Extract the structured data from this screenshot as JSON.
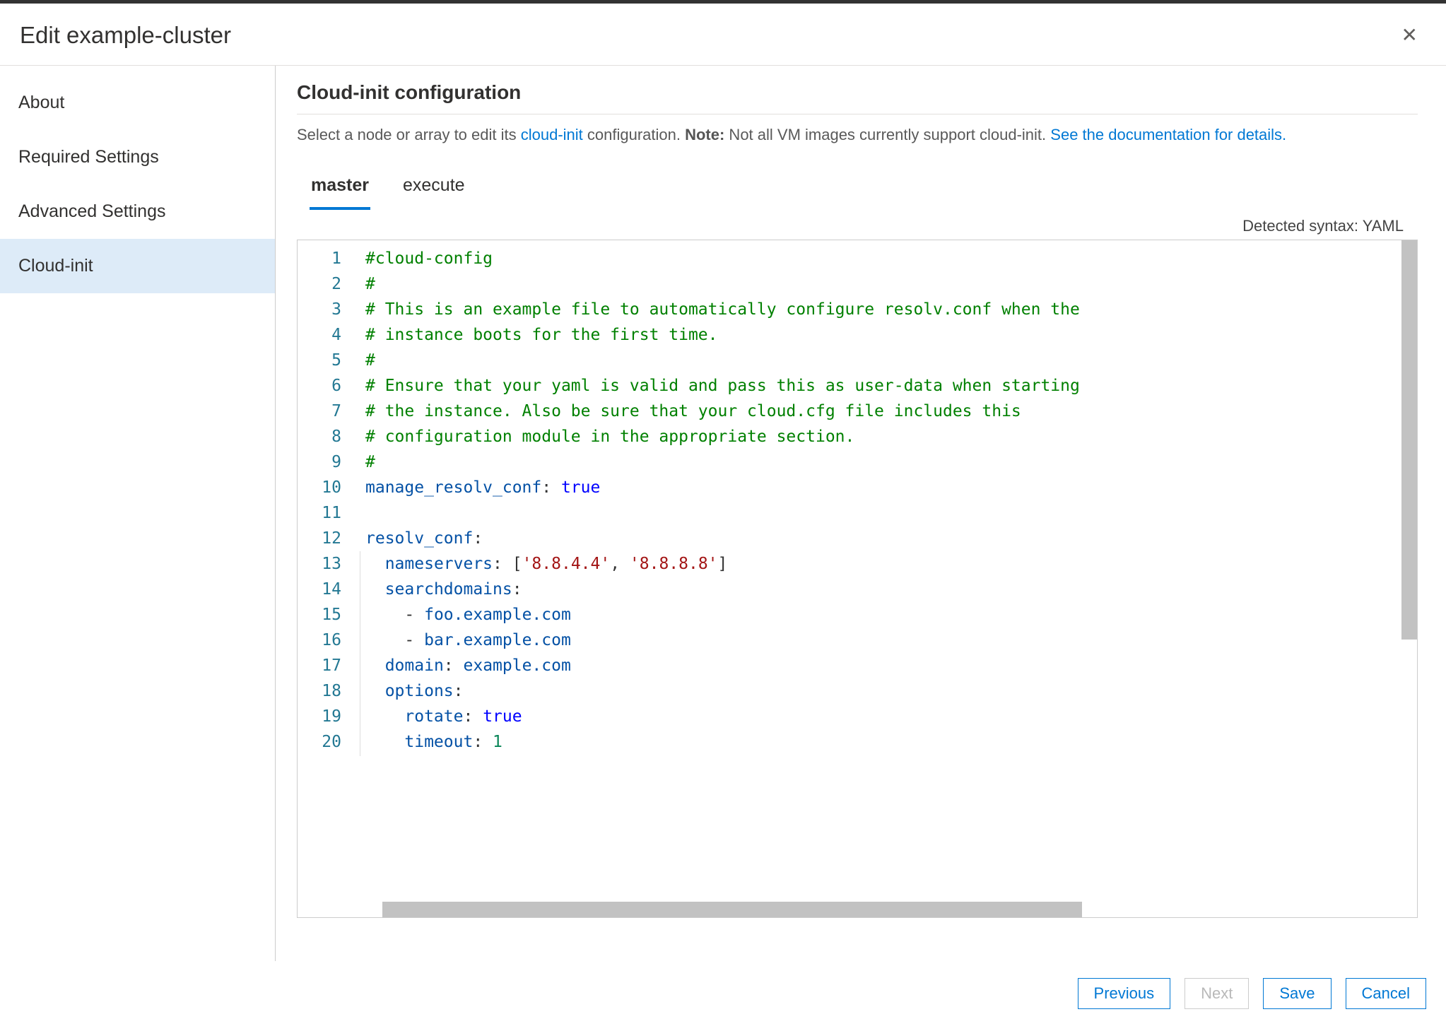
{
  "header": {
    "title": "Edit example-cluster"
  },
  "sidebar": {
    "items": [
      {
        "label": "About"
      },
      {
        "label": "Required Settings"
      },
      {
        "label": "Advanced Settings"
      },
      {
        "label": "Cloud-init"
      }
    ]
  },
  "main": {
    "section_title": "Cloud-init configuration",
    "subtitle_pre": "Select a node or array to edit its ",
    "subtitle_link1": "cloud-init",
    "subtitle_mid": " configuration. ",
    "subtitle_note_label": "Note:",
    "subtitle_note_text": " Not all VM images currently support cloud-init. ",
    "subtitle_link2": "See the documentation for details.",
    "tabs": [
      {
        "label": "master"
      },
      {
        "label": "execute"
      }
    ],
    "syntax_label": "Detected syntax: YAML"
  },
  "editor": {
    "lines": [
      {
        "n": "1",
        "tokens": [
          {
            "c": "comment",
            "t": "#cloud-config"
          }
        ]
      },
      {
        "n": "2",
        "tokens": [
          {
            "c": "comment",
            "t": "#"
          }
        ]
      },
      {
        "n": "3",
        "tokens": [
          {
            "c": "comment",
            "t": "# This is an example file to automatically configure resolv.conf when the"
          }
        ]
      },
      {
        "n": "4",
        "tokens": [
          {
            "c": "comment",
            "t": "# instance boots for the first time."
          }
        ]
      },
      {
        "n": "5",
        "tokens": [
          {
            "c": "comment",
            "t": "#"
          }
        ]
      },
      {
        "n": "6",
        "tokens": [
          {
            "c": "comment",
            "t": "# Ensure that your yaml is valid and pass this as user-data when starting"
          }
        ]
      },
      {
        "n": "7",
        "tokens": [
          {
            "c": "comment",
            "t": "# the instance. Also be sure that your cloud.cfg file includes this"
          }
        ]
      },
      {
        "n": "8",
        "tokens": [
          {
            "c": "comment",
            "t": "# configuration module in the appropriate section."
          }
        ]
      },
      {
        "n": "9",
        "tokens": [
          {
            "c": "comment",
            "t": "#"
          }
        ]
      },
      {
        "n": "10",
        "tokens": [
          {
            "c": "key",
            "t": "manage_resolv_conf"
          },
          {
            "c": "plain",
            "t": ": "
          },
          {
            "c": "bool",
            "t": "true"
          }
        ]
      },
      {
        "n": "11",
        "tokens": []
      },
      {
        "n": "12",
        "tokens": [
          {
            "c": "key",
            "t": "resolv_conf"
          },
          {
            "c": "plain",
            "t": ":"
          }
        ]
      },
      {
        "n": "13",
        "tokens": [
          {
            "c": "plain",
            "t": "  "
          },
          {
            "c": "key",
            "t": "nameservers"
          },
          {
            "c": "plain",
            "t": ": ["
          },
          {
            "c": "string",
            "t": "'8.8.4.4'"
          },
          {
            "c": "plain",
            "t": ", "
          },
          {
            "c": "string",
            "t": "'8.8.8.8'"
          },
          {
            "c": "plain",
            "t": "]"
          }
        ]
      },
      {
        "n": "14",
        "tokens": [
          {
            "c": "plain",
            "t": "  "
          },
          {
            "c": "key",
            "t": "searchdomains"
          },
          {
            "c": "plain",
            "t": ":"
          }
        ]
      },
      {
        "n": "15",
        "tokens": [
          {
            "c": "plain",
            "t": "    - "
          },
          {
            "c": "key",
            "t": "foo.example.com"
          }
        ]
      },
      {
        "n": "16",
        "tokens": [
          {
            "c": "plain",
            "t": "    - "
          },
          {
            "c": "key",
            "t": "bar.example.com"
          }
        ]
      },
      {
        "n": "17",
        "tokens": [
          {
            "c": "plain",
            "t": "  "
          },
          {
            "c": "key",
            "t": "domain"
          },
          {
            "c": "plain",
            "t": ": "
          },
          {
            "c": "key",
            "t": "example.com"
          }
        ]
      },
      {
        "n": "18",
        "tokens": [
          {
            "c": "plain",
            "t": "  "
          },
          {
            "c": "key",
            "t": "options"
          },
          {
            "c": "plain",
            "t": ":"
          }
        ]
      },
      {
        "n": "19",
        "tokens": [
          {
            "c": "plain",
            "t": "    "
          },
          {
            "c": "key",
            "t": "rotate"
          },
          {
            "c": "plain",
            "t": ": "
          },
          {
            "c": "bool",
            "t": "true"
          }
        ]
      },
      {
        "n": "20",
        "tokens": [
          {
            "c": "plain",
            "t": "    "
          },
          {
            "c": "key",
            "t": "timeout"
          },
          {
            "c": "plain",
            "t": ": "
          },
          {
            "c": "num",
            "t": "1"
          }
        ]
      }
    ]
  },
  "footer": {
    "previous": "Previous",
    "next": "Next",
    "save": "Save",
    "cancel": "Cancel"
  }
}
